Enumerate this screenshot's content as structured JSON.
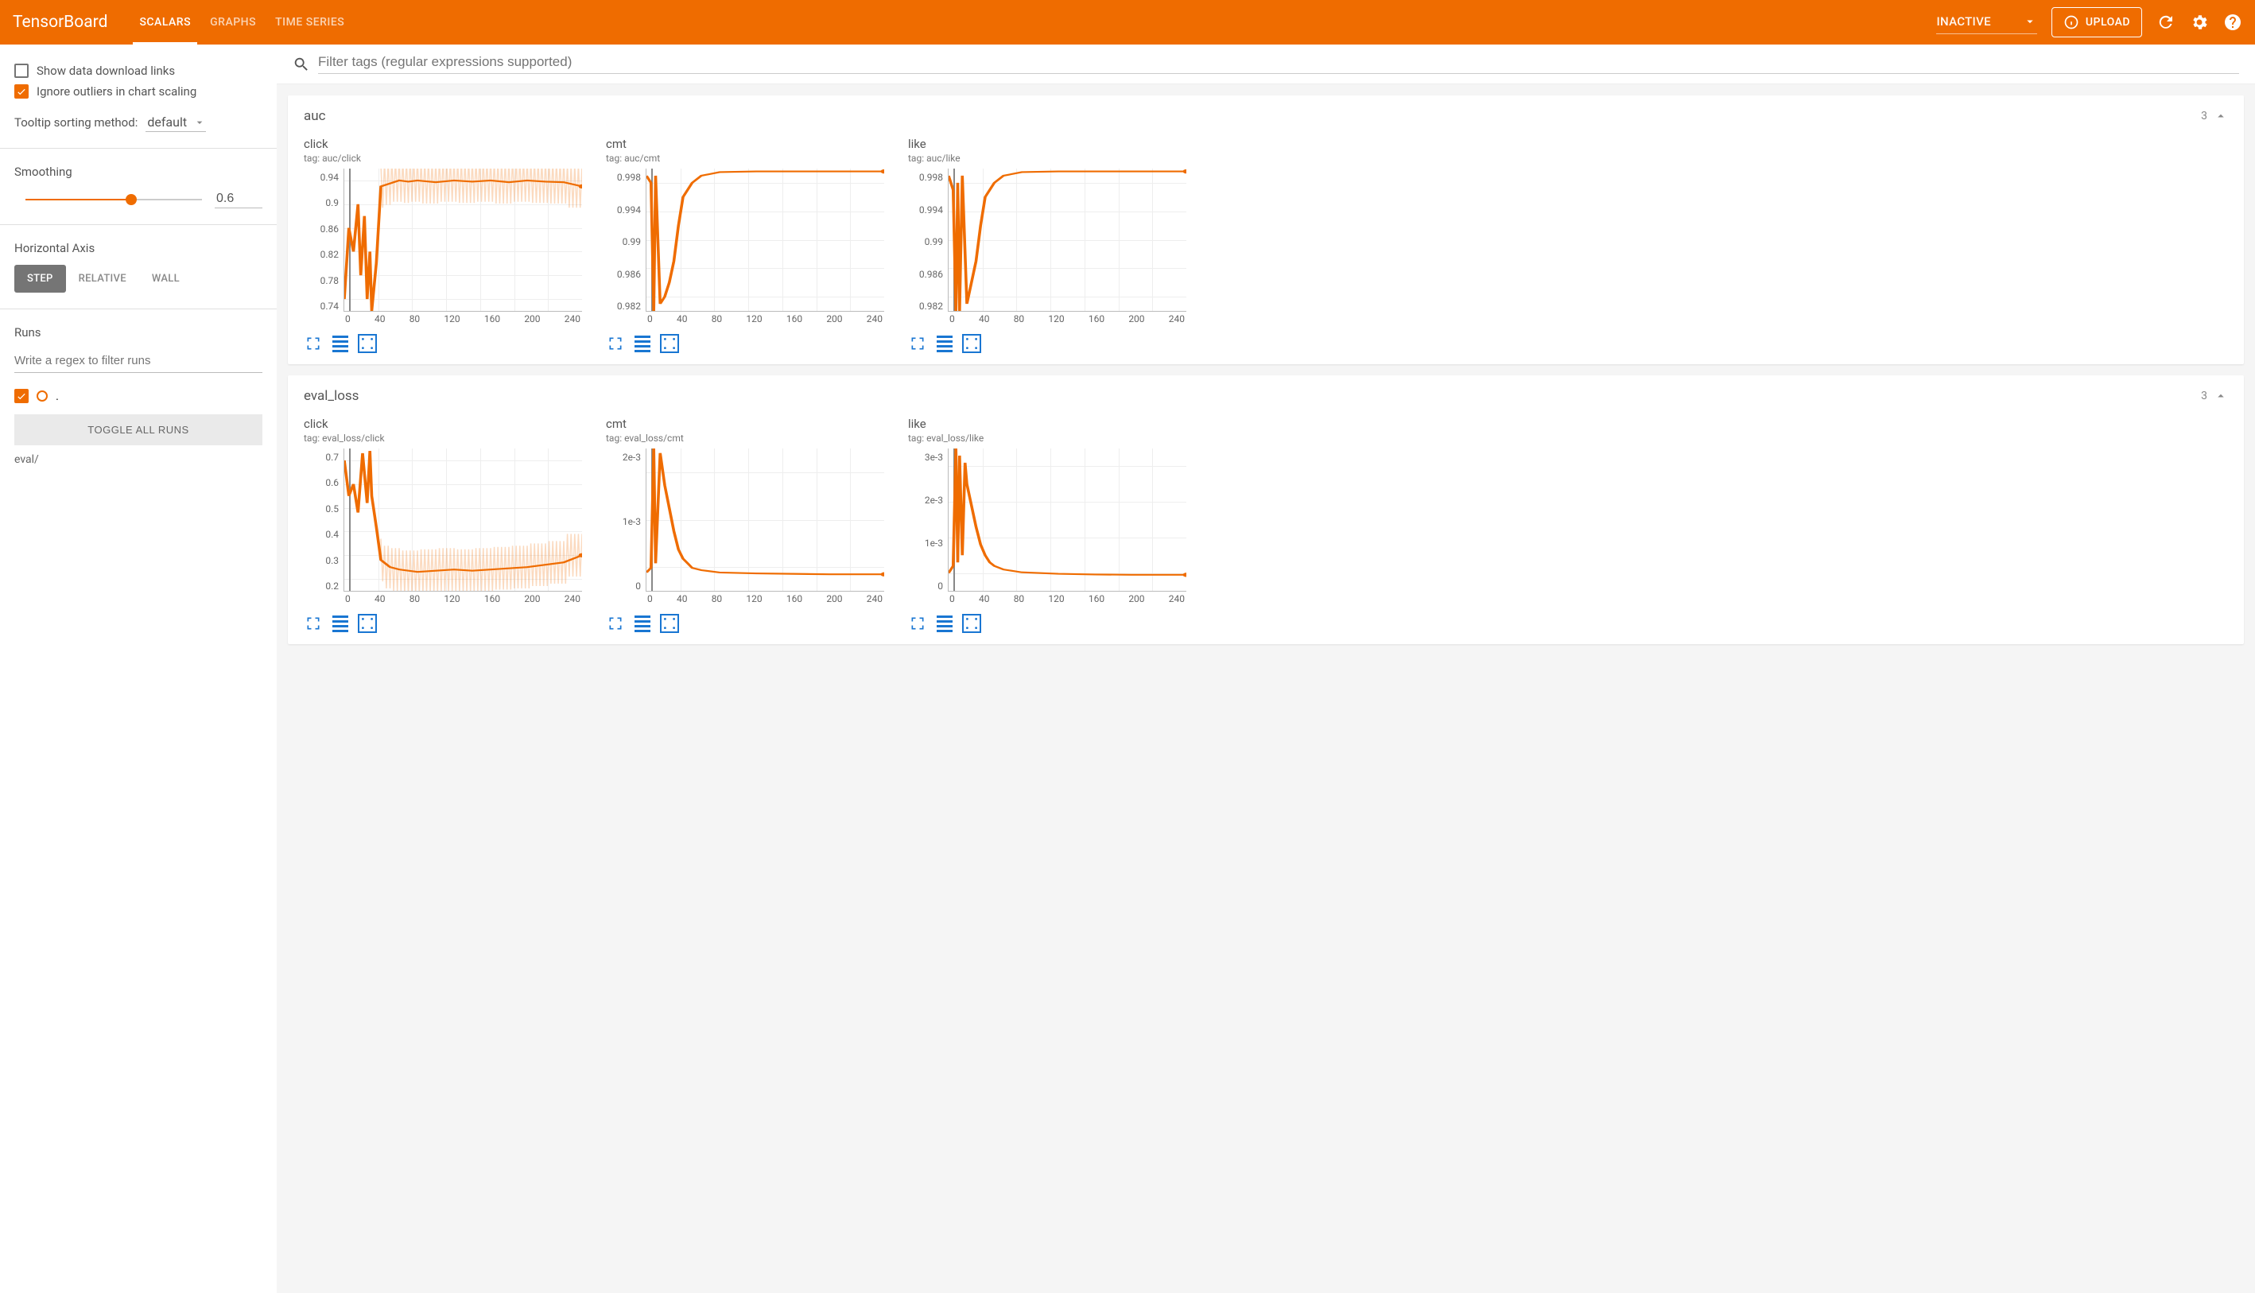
{
  "header": {
    "logo": "TensorBoard",
    "tabs": [
      "SCALARS",
      "GRAPHS",
      "TIME SERIES"
    ],
    "activeTab": 0,
    "dropdown": "INACTIVE",
    "upload": "UPLOAD"
  },
  "sidebar": {
    "showDownloadLabel": "Show data download links",
    "showDownloadChecked": false,
    "ignoreOutliersLabel": "Ignore outliers in chart scaling",
    "ignoreOutliersChecked": true,
    "tooltipLabel": "Tooltip sorting method:",
    "tooltipValue": "default",
    "smoothingLabel": "Smoothing",
    "smoothingValue": "0.6",
    "horizontalAxisLabel": "Horizontal Axis",
    "axisButtons": [
      "STEP",
      "RELATIVE",
      "WALL"
    ],
    "axisActive": 0,
    "runsLabel": "Runs",
    "runsPlaceholder": "Write a regex to filter runs",
    "runName": ".",
    "toggleRuns": "TOGGLE ALL RUNS",
    "runCategory": "eval/",
    "colors": {
      "accent": "#ef6c00"
    }
  },
  "filter": {
    "placeholder": "Filter tags (regular expressions supported)"
  },
  "categories": [
    {
      "name": "auc",
      "count": "3",
      "key": "auc"
    },
    {
      "name": "eval_loss",
      "count": "3",
      "key": "eval_loss"
    }
  ],
  "chart_data": [
    {
      "group": "auc",
      "title": "click",
      "tag": "tag: auc/click",
      "type": "line",
      "xlabel": "",
      "ylabel": "",
      "xlim": [
        0,
        260
      ],
      "ylim": [
        0.72,
        0.96
      ],
      "xticks": [
        0,
        40,
        80,
        120,
        160,
        200,
        240
      ],
      "yticks": [
        "0.94",
        "0.9",
        "0.86",
        "0.82",
        "0.78",
        "0.74"
      ],
      "series": [
        {
          "name": ".",
          "color": "#ef6c00",
          "x": [
            0,
            5,
            10,
            15,
            18,
            22,
            25,
            28,
            30,
            35,
            40,
            50,
            60,
            70,
            80,
            100,
            120,
            140,
            160,
            180,
            200,
            220,
            240,
            260
          ],
          "y": [
            0.74,
            0.86,
            0.82,
            0.9,
            0.78,
            0.88,
            0.74,
            0.82,
            0.72,
            0.8,
            0.93,
            0.935,
            0.94,
            0.938,
            0.94,
            0.937,
            0.94,
            0.938,
            0.94,
            0.937,
            0.94,
            0.938,
            0.937,
            0.93
          ]
        }
      ],
      "oscillation": true
    },
    {
      "group": "auc",
      "title": "cmt",
      "tag": "tag: auc/cmt",
      "type": "line",
      "xlim": [
        0,
        260
      ],
      "ylim": [
        0.98,
        1.0
      ],
      "xticks": [
        0,
        40,
        80,
        120,
        160,
        200,
        240
      ],
      "yticks": [
        "0.998",
        "0.994",
        "0.99",
        "0.986",
        "0.982"
      ],
      "series": [
        {
          "name": ".",
          "color": "#ef6c00",
          "x": [
            0,
            5,
            8,
            10,
            15,
            20,
            25,
            30,
            35,
            40,
            50,
            60,
            80,
            120,
            160,
            200,
            260
          ],
          "y": [
            0.999,
            0.998,
            0.98,
            0.999,
            0.981,
            0.982,
            0.984,
            0.987,
            0.992,
            0.996,
            0.998,
            0.999,
            0.9995,
            0.9996,
            0.9996,
            0.9996,
            0.9996
          ]
        }
      ]
    },
    {
      "group": "auc",
      "title": "like",
      "tag": "tag: auc/like",
      "type": "line",
      "xlim": [
        0,
        260
      ],
      "ylim": [
        0.98,
        1.0
      ],
      "xticks": [
        0,
        40,
        80,
        120,
        160,
        200,
        240
      ],
      "yticks": [
        "0.998",
        "0.994",
        "0.99",
        "0.986",
        "0.982"
      ],
      "series": [
        {
          "name": ".",
          "color": "#ef6c00",
          "x": [
            0,
            5,
            8,
            10,
            12,
            15,
            20,
            25,
            30,
            35,
            40,
            50,
            60,
            80,
            120,
            160,
            200,
            260
          ],
          "y": [
            0.999,
            0.997,
            0.98,
            0.998,
            0.98,
            0.999,
            0.981,
            0.984,
            0.987,
            0.992,
            0.996,
            0.998,
            0.999,
            0.9995,
            0.9996,
            0.9996,
            0.9996,
            0.9996
          ]
        }
      ]
    },
    {
      "group": "eval_loss",
      "title": "click",
      "tag": "tag: eval_loss/click",
      "type": "line",
      "xlim": [
        0,
        260
      ],
      "ylim": [
        0.15,
        0.75
      ],
      "xticks": [
        0,
        40,
        80,
        120,
        160,
        200,
        240
      ],
      "yticks": [
        "0.7",
        "0.6",
        "0.5",
        "0.4",
        "0.3",
        "0.2"
      ],
      "series": [
        {
          "name": ".",
          "color": "#ef6c00",
          "x": [
            0,
            5,
            10,
            15,
            20,
            25,
            28,
            30,
            35,
            40,
            50,
            60,
            80,
            100,
            120,
            140,
            160,
            180,
            200,
            220,
            240,
            260
          ],
          "y": [
            0.7,
            0.55,
            0.6,
            0.48,
            0.73,
            0.52,
            0.74,
            0.55,
            0.42,
            0.28,
            0.25,
            0.24,
            0.23,
            0.235,
            0.24,
            0.235,
            0.24,
            0.245,
            0.25,
            0.26,
            0.27,
            0.3
          ]
        }
      ],
      "oscillation": true
    },
    {
      "group": "eval_loss",
      "title": "cmt",
      "tag": "tag: eval_loss/cmt",
      "type": "line",
      "xlim": [
        0,
        260
      ],
      "ylim": [
        -0.0003,
        0.0028
      ],
      "xticks": [
        0,
        40,
        80,
        120,
        160,
        200,
        240
      ],
      "yticks": [
        "2e-3",
        "1e-3",
        "0"
      ],
      "series": [
        {
          "name": ".",
          "color": "#ef6c00",
          "x": [
            0,
            5,
            8,
            10,
            15,
            20,
            25,
            30,
            35,
            40,
            45,
            50,
            60,
            80,
            120,
            160,
            200,
            260
          ],
          "y": [
            0.0001,
            0.0002,
            0.0028,
            0.0003,
            0.0027,
            0.002,
            0.0015,
            0.001,
            0.0006,
            0.0004,
            0.0003,
            0.0002,
            0.00015,
            0.0001,
            8e-05,
            7e-05,
            6e-05,
            6e-05
          ]
        }
      ]
    },
    {
      "group": "eval_loss",
      "title": "like",
      "tag": "tag: eval_loss/like",
      "type": "line",
      "xlim": [
        0,
        260
      ],
      "ylim": [
        -0.0004,
        0.0036
      ],
      "xticks": [
        0,
        40,
        80,
        120,
        160,
        200,
        240
      ],
      "yticks": [
        "3e-3",
        "2e-3",
        "1e-3",
        "0"
      ],
      "series": [
        {
          "name": ".",
          "color": "#ef6c00",
          "x": [
            0,
            5,
            8,
            10,
            12,
            15,
            18,
            20,
            25,
            30,
            35,
            40,
            45,
            50,
            60,
            80,
            120,
            160,
            200,
            260
          ],
          "y": [
            0.0001,
            0.0003,
            0.0036,
            0.0004,
            0.0034,
            0.0006,
            0.0032,
            0.0026,
            0.002,
            0.0014,
            0.0009,
            0.0006,
            0.0004,
            0.0003,
            0.0002,
            0.00012,
            8e-05,
            6e-05,
            5e-05,
            5e-05
          ]
        }
      ]
    }
  ]
}
